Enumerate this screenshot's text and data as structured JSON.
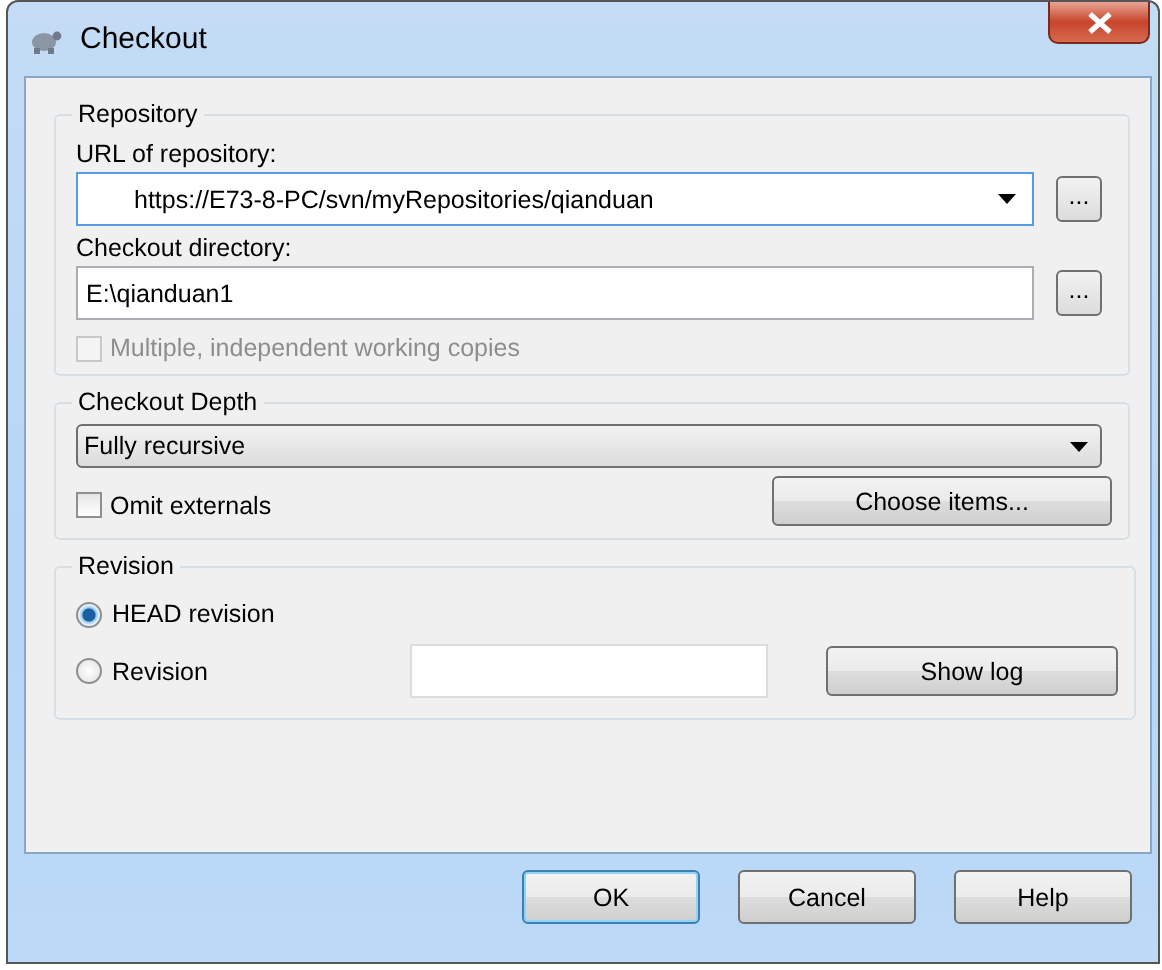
{
  "window": {
    "title": "Checkout"
  },
  "repository": {
    "title": "Repository",
    "url_label": "URL of repository:",
    "url_value": "https://E73-8-PC/svn/myRepositories/qianduan",
    "url_browse": "...",
    "dir_label": "Checkout directory:",
    "dir_value": "E:\\qianduan1",
    "dir_browse": "...",
    "multiple": {
      "label": "Multiple, independent working copies",
      "checked": false,
      "disabled": true
    }
  },
  "depth": {
    "title": "Checkout Depth",
    "value": "Fully recursive",
    "omit_externals": {
      "label": "Omit externals",
      "checked": false,
      "disabled": false
    },
    "choose_button": "Choose items..."
  },
  "revision": {
    "title": "Revision",
    "options": [
      {
        "label": "HEAD revision",
        "selected": true
      },
      {
        "label": "Revision",
        "selected": false
      }
    ],
    "show_log": "Show log"
  },
  "buttons": [
    {
      "label": "OK",
      "default": true
    },
    {
      "label": "Cancel",
      "default": false
    },
    {
      "label": "Help",
      "default": false
    }
  ]
}
